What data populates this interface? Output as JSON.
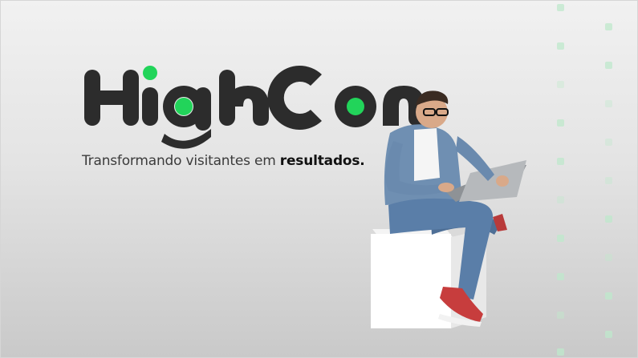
{
  "brand": {
    "letters": [
      "H",
      "i",
      "g",
      "h",
      "C",
      "o",
      "n"
    ],
    "accent_color": "#22d45a",
    "text_color": "#2c2c2c"
  },
  "tagline": {
    "lead": "Transformando visitantes em ",
    "bold": "resultados."
  },
  "hero_image": {
    "subject": "man-with-laptop-on-cube"
  }
}
